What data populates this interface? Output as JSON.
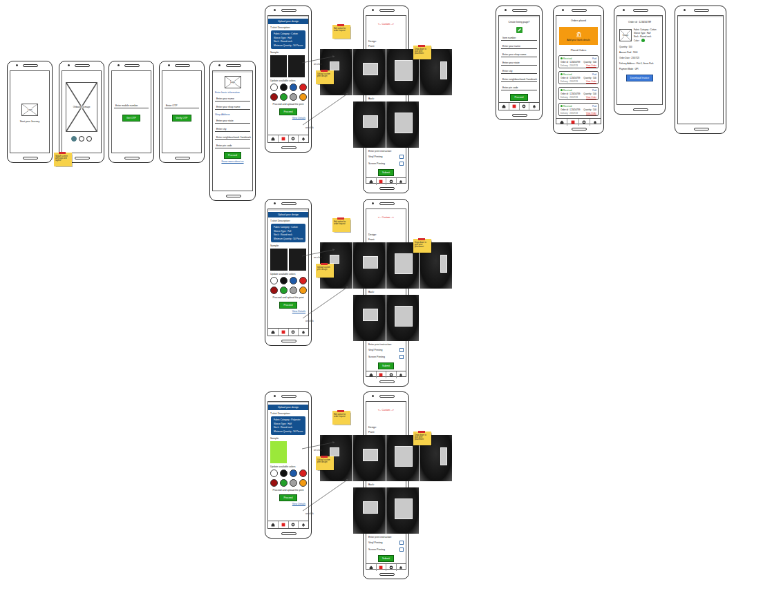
{
  "onboarding": [
    {
      "kind": "splash",
      "image": "Logo",
      "text": "Start your Journey"
    },
    {
      "kind": "intro",
      "image": "Onboarding image",
      "dots": [
        {
          "selected": true
        },
        {
          "selected": false
        },
        {
          "selected": false
        }
      ]
    },
    {
      "kind": "input",
      "field": "Enter mobile number",
      "button": "Get OTP"
    },
    {
      "kind": "input",
      "field": "Enter OTP",
      "button": "Verify OTP"
    }
  ],
  "splash_note": "Splash screen with logo and tagline",
  "registration": {
    "logo": "Logo",
    "sections": [
      {
        "kind": "heading",
        "text": "Enter basic information"
      },
      {
        "kind": "field",
        "text": "Enter your name"
      },
      {
        "kind": "field",
        "text": "Enter your shop name"
      },
      {
        "kind": "heading",
        "text": "Shop Address"
      },
      {
        "kind": "field",
        "text": "Enter your state"
      },
      {
        "kind": "field",
        "text": "Enter city"
      },
      {
        "kind": "field",
        "text": "Enter neighbourhood / landmark"
      },
      {
        "kind": "field",
        "text": "Enter pin code"
      }
    ],
    "button": "Proceed",
    "link": "Know more about us"
  },
  "nav": [
    {
      "kind": "home",
      "selected": false
    },
    {
      "kind": "orders",
      "selected": true
    },
    {
      "kind": "settings",
      "selected": false
    },
    {
      "kind": "alerts",
      "selected": false
    }
  ],
  "flows": [
    {
      "form": {
        "header": "Upload your design",
        "desc_title": "T-shirt Description:",
        "desc": [
          "Fabric Category : Cotton",
          "Sleeve Type : Half",
          "Neck : Round neck",
          "Minimum Quantity : 50 Pieces"
        ],
        "sample_label": "Sample:",
        "samples": [
          {
            "color": "#1b1b1b",
            "kind": "tee"
          },
          {
            "color": "#1b1b1b",
            "kind": "tee"
          }
        ],
        "colors_label": "Update available colors",
        "colors": [
          {
            "color": "#ffffff"
          },
          {
            "color": "#111111"
          },
          {
            "color": "#1e5aa8"
          },
          {
            "color": "#d81f1f"
          },
          {
            "color": "#9b1010"
          },
          {
            "color": "#22a02a"
          },
          {
            "color": "#a0a0a0"
          },
          {
            "color": "#f39a12"
          }
        ],
        "proceed_label": "Proceed and upload the print",
        "button": "Proceed",
        "link": "View Details"
      },
      "custom": {
        "title": "<-- Custom -->",
        "design_label": "Design:",
        "front_label": "Front:",
        "front": [
          {
            "kind": "left-chest"
          },
          {
            "kind": "center"
          },
          {
            "kind": "full"
          },
          {
            "kind": "sleeve"
          }
        ],
        "back_label": "Back:",
        "back": [
          {
            "kind": "center"
          },
          {
            "kind": "full"
          }
        ],
        "instruction_label": "Enter print instruction:",
        "options": [
          {
            "label": "Vinyl Printing",
            "checked": false
          },
          {
            "label": "Screen Printing",
            "checked": false
          }
        ],
        "button": "Submit"
      },
      "arrows": [
        "on click",
        "on click"
      ],
      "notes": [
        "Edit option for order request",
        "Drop-down to pick print placement",
        "Upload custom print design"
      ]
    },
    {
      "form": {
        "header": "Upload your design",
        "desc_title": "T-shirt Description:",
        "desc": [
          "Fabric Category : Cotton",
          "Sleeve Type : Full",
          "Neck : Round neck",
          "Minimum Quantity : 50 Pieces"
        ],
        "sample_label": "Sample:",
        "samples": [
          {
            "color": "#1b1b1b",
            "kind": "long"
          },
          {
            "color": "#1b1b1b",
            "kind": "long"
          }
        ],
        "colors_label": "Update available colors",
        "colors": [
          {
            "color": "#ffffff"
          },
          {
            "color": "#111111"
          },
          {
            "color": "#1e5aa8"
          },
          {
            "color": "#d81f1f"
          },
          {
            "color": "#9b1010"
          },
          {
            "color": "#22a02a"
          },
          {
            "color": "#a0a0a0"
          },
          {
            "color": "#f39a12"
          }
        ],
        "proceed_label": "Proceed and upload the print",
        "button": "Proceed",
        "link": "View Details"
      },
      "custom": {
        "title": "<-- Custom -->",
        "design_label": "Design:",
        "front_label": "Front:",
        "front": [
          {
            "kind": "left-chest"
          },
          {
            "kind": "center"
          },
          {
            "kind": "full"
          },
          {
            "kind": "sleeve"
          }
        ],
        "back_label": "Back:",
        "back": [
          {
            "kind": "center"
          },
          {
            "kind": "full"
          }
        ],
        "instruction_label": "Enter print instruction:",
        "options": [
          {
            "label": "Vinyl Printing",
            "checked": false
          },
          {
            "label": "Screen Printing",
            "checked": false
          }
        ],
        "button": "Submit"
      },
      "arrows": [
        "on click",
        "on click"
      ],
      "notes": [
        "Edit option for order request",
        "Drop-down to pick print placement",
        "Upload custom print design"
      ]
    },
    {
      "form": {
        "header": "Upload your design",
        "desc_title": "T-shirt Description:",
        "desc": [
          "Fabric Category : Polyester",
          "Sleeve Type : Half",
          "Neck : Round neck",
          "Minimum Quantity : 50 Pieces"
        ],
        "sample_label": "Sample:",
        "samples": [
          {
            "color": "#9be83a",
            "kind": "tee"
          }
        ],
        "colors_label": "Update available colors",
        "colors": [
          {
            "color": "#ffffff"
          },
          {
            "color": "#111111"
          },
          {
            "color": "#1e5aa8"
          },
          {
            "color": "#d81f1f"
          },
          {
            "color": "#9b1010"
          },
          {
            "color": "#22a02a"
          },
          {
            "color": "#a0a0a0"
          },
          {
            "color": "#f39a12"
          }
        ],
        "proceed_label": "Proceed and upload the print",
        "button": "Proceed",
        "link": "View Details"
      },
      "custom": {
        "title": "<-- Custom -->",
        "design_label": "Design:",
        "front_label": "Front:",
        "front": [
          {
            "kind": "left-chest"
          },
          {
            "kind": "center"
          },
          {
            "kind": "full"
          },
          {
            "kind": "sleeve"
          }
        ],
        "back_label": "Back:",
        "back": [
          {
            "kind": "center"
          },
          {
            "kind": "full"
          }
        ],
        "instruction_label": "Enter print instruction:",
        "options": [
          {
            "label": "Vinyl Printing",
            "checked": false
          },
          {
            "label": "Screen Printing",
            "checked": false
          }
        ],
        "button": "Submit"
      },
      "arrows": [
        "on click",
        "on click"
      ],
      "notes": [
        "Edit option for order request",
        "Drop-down to pick print placement",
        "Upload custom print design"
      ]
    }
  ],
  "listing": {
    "title": "Create listing page?",
    "fields": [
      "Item number",
      "Enter your name",
      "Enter your shop name",
      "Enter your state",
      "Enter city",
      "Enter neighbourhood / landmark",
      "Enter pin code"
    ],
    "button": "Proceed"
  },
  "orders": {
    "title": "Orders placed",
    "bank": "Add your bank details",
    "heading": "Placed Orders",
    "cards": [
      {
        "status": "Received",
        "payment": "Paid",
        "order": "Order id : 123456789",
        "quantity": "Quantity : 500",
        "date": "Delivery : 23/07/23",
        "link": "View Order"
      },
      {
        "status": "Received",
        "payment": "Paid",
        "order": "Order id : 123456789",
        "quantity": "Quantity : 500",
        "date": "Delivery : 23/07/23",
        "link": "View Order"
      },
      {
        "status": "Received",
        "payment": "Paid",
        "order": "Order id : 123456789",
        "quantity": "Quantity : 500",
        "date": "Delivery : 23/07/23",
        "link": "View Order"
      },
      {
        "status": "Received",
        "payment": "Paid",
        "order": "Order id : 123456789",
        "quantity": "Quantity : 500",
        "date": "Delivery : 23/07/23",
        "link": "View Order"
      }
    ]
  },
  "detail": {
    "title": "Order id : 123456789",
    "image": "Image",
    "specs": [
      "Fabric Category : Cotton",
      "Sleeve Type : Half",
      "Neck : Round neck"
    ],
    "color_label": "Color :",
    "color": "#22a02a",
    "lines": [
      "Quantity : 500",
      "Amount Paid : 7000",
      "Order Date : 23/07/23",
      "Delivery Address : Flat 4, Green Park",
      "Payment Mode : UPI"
    ],
    "button": "Download Invoice"
  }
}
